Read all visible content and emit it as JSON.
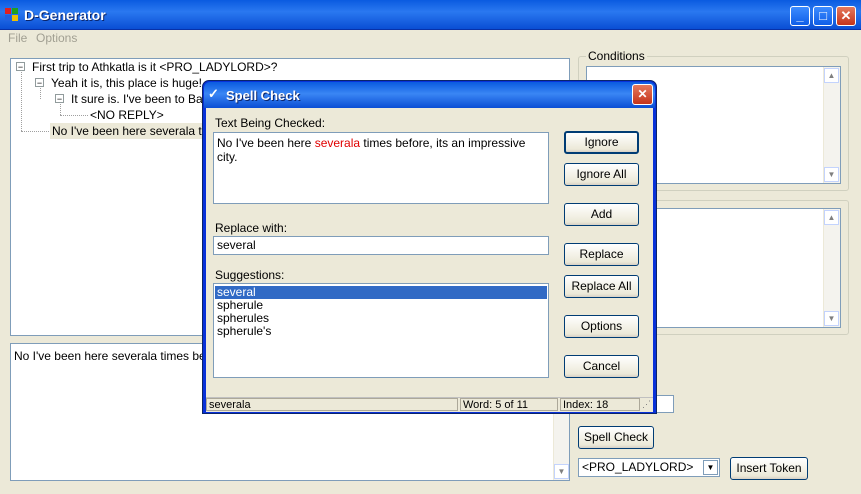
{
  "window": {
    "title": "D-Generator",
    "buttons": {
      "minimize": "_",
      "maximize": "□",
      "close": "✕"
    }
  },
  "menu": {
    "file": "File",
    "options": "Options"
  },
  "tree": {
    "nodes": [
      {
        "text": "First trip to Athkatla is it <PRO_LADYLORD>?",
        "expander": "−"
      },
      {
        "text": "Yeah it is, this place is huge!",
        "expander": "−"
      },
      {
        "text": "It sure is. I've been to Baldu",
        "expander": "−"
      },
      {
        "text": "<NO REPLY>"
      },
      {
        "text": "No I've been here severala time"
      }
    ]
  },
  "reply_text": "No I've been here severala times before",
  "conditions": {
    "label": "Conditions"
  },
  "bottom": {
    "spell_check_label": "Spell Check",
    "token_value": "<PRO_LADYLORD>",
    "insert_token_label": "Insert Token"
  },
  "dialog": {
    "title": "Spell Check",
    "text_label": "Text Being Checked:",
    "text_before": "No I've been here ",
    "misspelled": "severala",
    "text_after": " times before, its an impressive city.",
    "replace_label": "Replace with:",
    "replace_value": "several",
    "suggestions_label": "Suggestions:",
    "suggestions": [
      "several",
      "spherule",
      "spherules",
      "spherule's"
    ],
    "buttons": {
      "ignore": "Ignore",
      "ignore_all": "Ignore All",
      "add": "Add",
      "replace": "Replace",
      "replace_all": "Replace All",
      "options": "Options",
      "cancel": "Cancel"
    },
    "status": {
      "word": "severala",
      "position": "Word: 5 of 11",
      "index": "Index: 18"
    }
  },
  "colors": {
    "title_bar": "#0a5be0",
    "misspelled_text": "#e00000",
    "selection": "#316ac5"
  }
}
